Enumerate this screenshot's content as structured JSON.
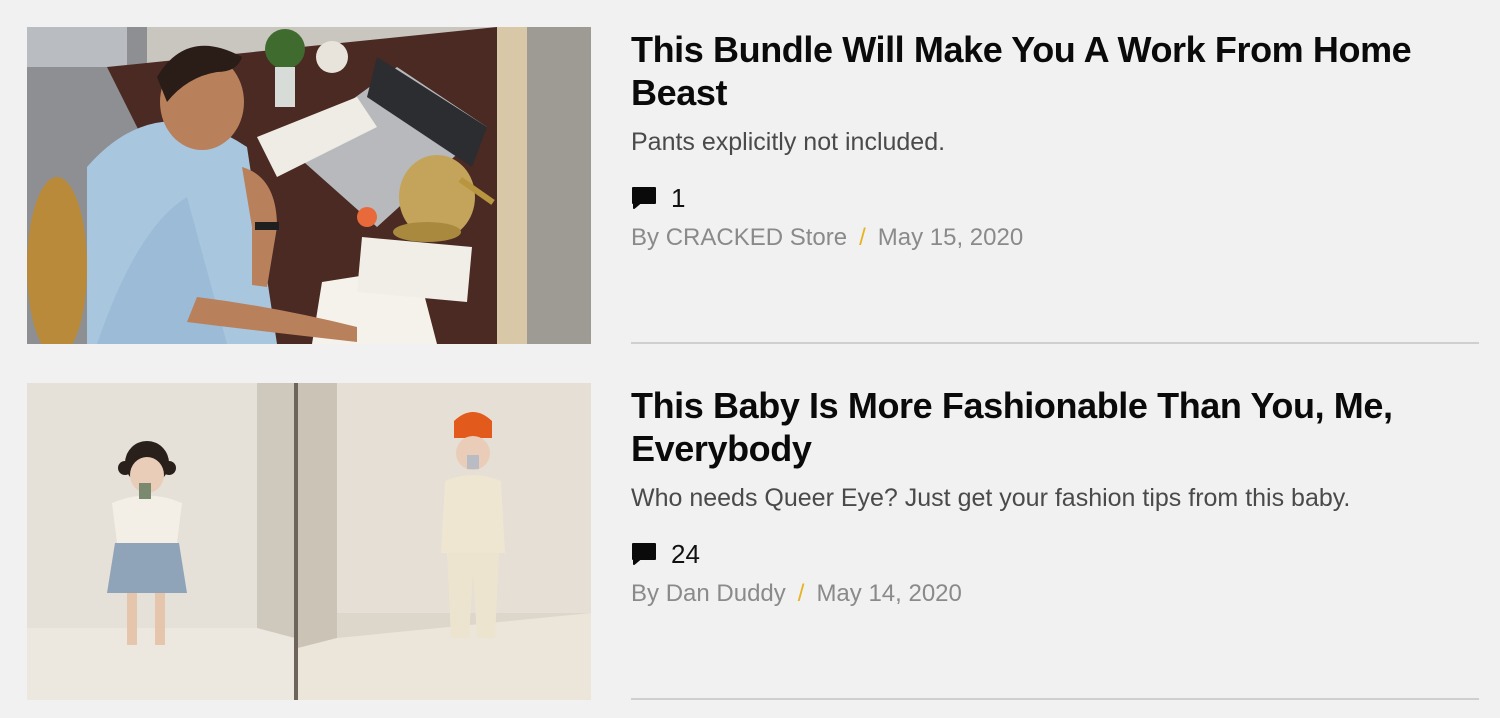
{
  "articles": [
    {
      "title": "This Bundle Will Make You A Work From Home Beast",
      "subtitle": "Pants explicitly not included.",
      "comment_count": "1",
      "byline_prefix": "By",
      "author": "CRACKED Store",
      "separator": "/",
      "date": "May 15, 2020",
      "image_icon": "man-at-desk-photo"
    },
    {
      "title": "This Baby Is More Fashionable Than You, Me, Everybody",
      "subtitle": "Who needs Queer Eye? Just get your fashion tips from this baby.",
      "comment_count": "24",
      "byline_prefix": "By",
      "author": "Dan Duddy",
      "separator": "/",
      "date": "May 14, 2020",
      "image_icon": "baby-outfits-photo"
    }
  ],
  "colors": {
    "background": "#f1f1f1",
    "title": "#0a0a0a",
    "subtitle": "#4a4a4a",
    "meta": "#8a8a8a",
    "separator_accent": "#e6b422",
    "divider": "#cfcfcf"
  }
}
